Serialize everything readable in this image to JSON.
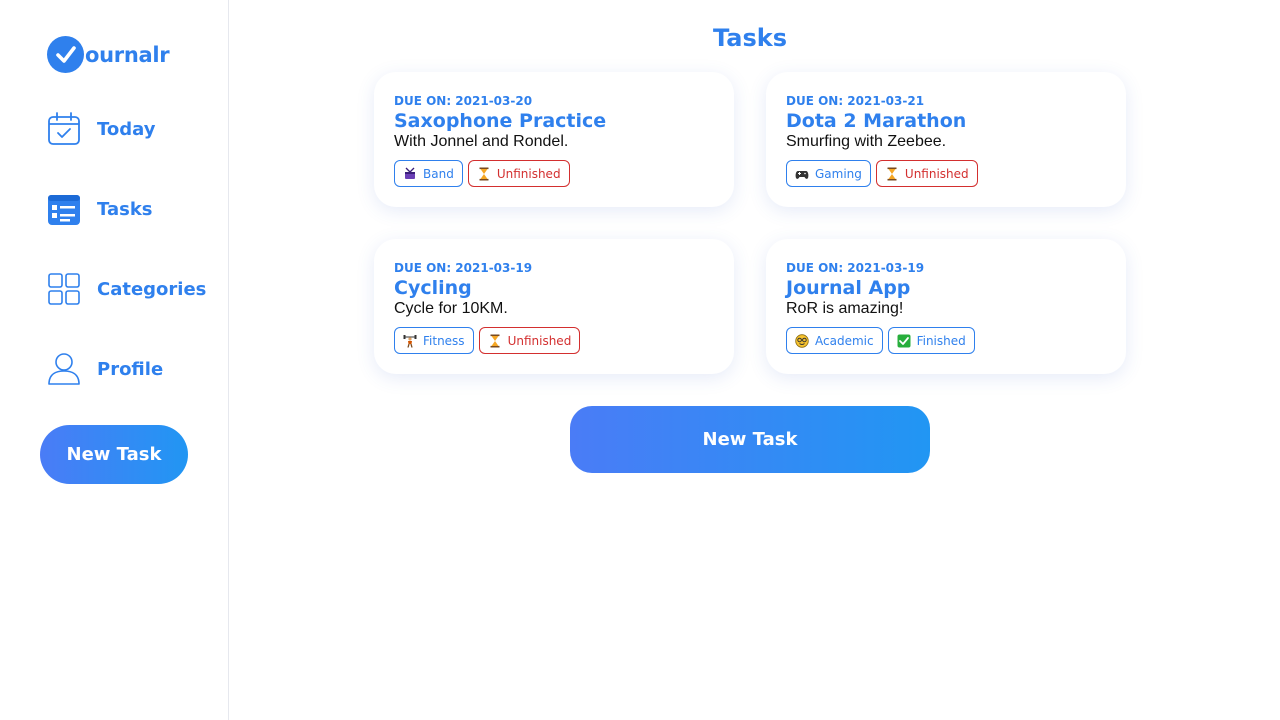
{
  "app": {
    "logo_text": "ournalr"
  },
  "colors": {
    "accent": "#2f80ed",
    "danger": "#d32f2f",
    "button_gradient_start": "#4a7cf6",
    "button_gradient_end": "#2196f3"
  },
  "sidebar": {
    "items": [
      {
        "label": "Today",
        "icon": "calendar-check-icon"
      },
      {
        "label": "Tasks",
        "icon": "task-list-icon"
      },
      {
        "label": "Categories",
        "icon": "grid-icon"
      },
      {
        "label": "Profile",
        "icon": "user-icon"
      }
    ],
    "new_task_label": "New Task"
  },
  "main": {
    "title": "Tasks",
    "new_task_label": "New Task",
    "tasks": [
      {
        "due": "DUE ON: 2021-03-20",
        "title": "Saxophone Practice",
        "description": "With Jonnel and Rondel.",
        "category": {
          "label": "Band",
          "icon": "drum-icon"
        },
        "status": {
          "label": "Unfinished",
          "icon": "hourglass-icon",
          "kind": "unfin"
        }
      },
      {
        "due": "DUE ON: 2021-03-21",
        "title": "Dota 2 Marathon",
        "description": "Smurfing with Zeebee.",
        "category": {
          "label": "Gaming",
          "icon": "gamepad-icon"
        },
        "status": {
          "label": "Unfinished",
          "icon": "hourglass-icon",
          "kind": "unfin"
        }
      },
      {
        "due": "DUE ON: 2021-03-19",
        "title": "Cycling",
        "description": "Cycle for 10KM.",
        "category": {
          "label": "Fitness",
          "icon": "weightlifter-icon"
        },
        "status": {
          "label": "Unfinished",
          "icon": "hourglass-icon",
          "kind": "unfin"
        }
      },
      {
        "due": "DUE ON: 2021-03-19",
        "title": "Journal App",
        "description": "RoR is amazing!",
        "category": {
          "label": "Academic",
          "icon": "nerd-face-icon"
        },
        "status": {
          "label": "Finished",
          "icon": "check-box-icon",
          "kind": "fin"
        }
      }
    ]
  }
}
